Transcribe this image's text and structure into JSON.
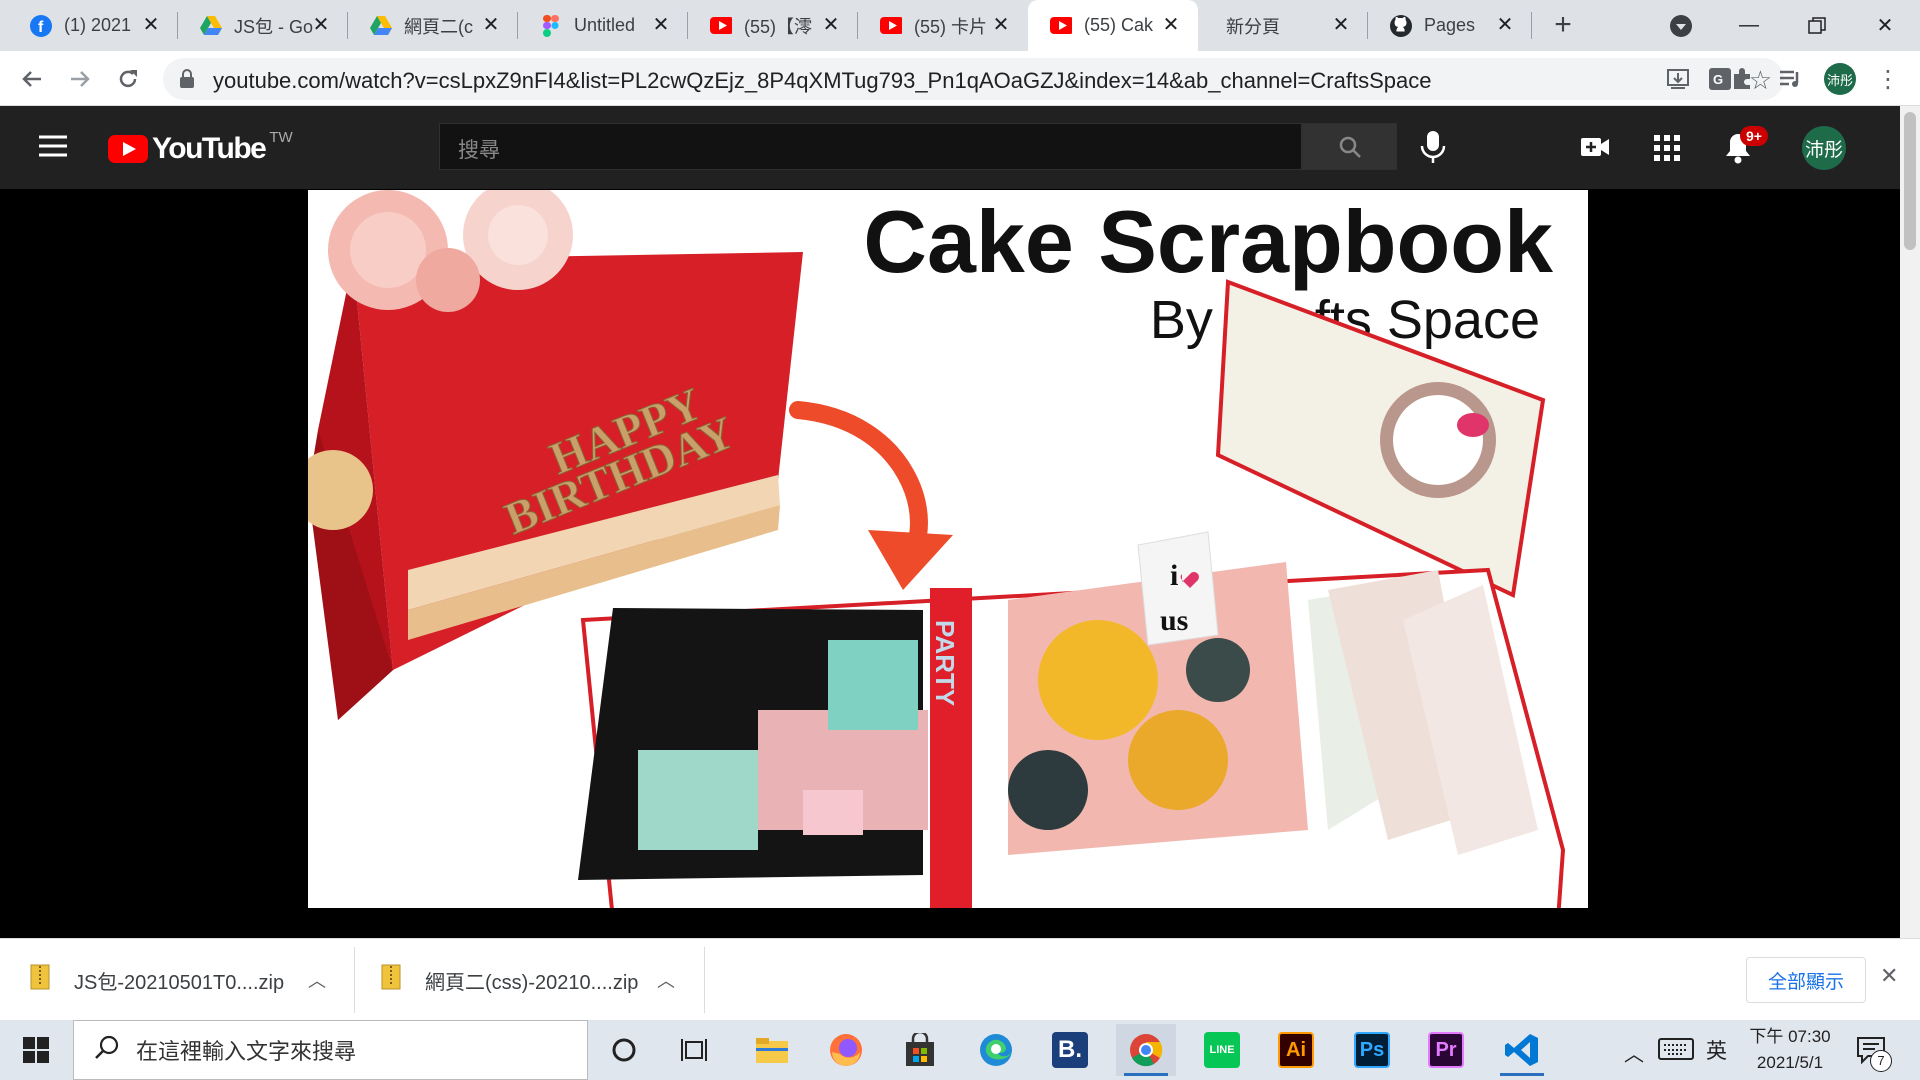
{
  "browser": {
    "tabs": [
      {
        "title": "(1) 2021",
        "icon": "facebook-icon"
      },
      {
        "title": "JS包 - Go",
        "icon": "google-drive-icon"
      },
      {
        "title": "網頁二(c",
        "icon": "google-drive-icon"
      },
      {
        "title": "Untitled",
        "icon": "figma-icon"
      },
      {
        "title": "(55)【澪",
        "icon": "youtube-icon"
      },
      {
        "title": "(55) 卡片",
        "icon": "youtube-icon"
      },
      {
        "title": "(55) Cak",
        "icon": "youtube-icon",
        "active": true
      },
      {
        "title": "新分頁",
        "icon": ""
      },
      {
        "title": "Pages",
        "icon": "github-icon"
      }
    ],
    "new_tab": "+",
    "url": "youtube.com/watch?v=csLpxZ9nFI4&list=PL2cwQzEjz_8P4qXMTug793_Pn1qAOaGZJ&index=14&ab_channel=CraftsSpace",
    "profile_initials": "沛彤"
  },
  "youtube": {
    "logo_text": "YouTube",
    "region": "TW",
    "search_placeholder": "搜尋",
    "notification_badge": "9+",
    "avatar_text": "沛彤"
  },
  "video": {
    "title_line1": "Cake Scrapbook",
    "title_line2": "By Crafts Space",
    "cake_text_line1": "HAPPY",
    "cake_text_line2": "BIRTHDAY",
    "badge_line1": "i",
    "badge_line2": "us",
    "pattern_word": "PARTY"
  },
  "downloads": {
    "items": [
      {
        "name": "JS包-20210501T0....zip"
      },
      {
        "name": "網頁二(css)-20210....zip"
      }
    ],
    "show_all": "全部顯示"
  },
  "taskbar": {
    "search_placeholder": "在這裡輸入文字來搜尋",
    "ime": "英",
    "time": "下午 07:30",
    "date": "2021/5/1",
    "notifications": "7"
  },
  "colors": {
    "yt_red": "#ff0000",
    "yt_header": "#212121",
    "accent_blue": "#1a73e8"
  }
}
